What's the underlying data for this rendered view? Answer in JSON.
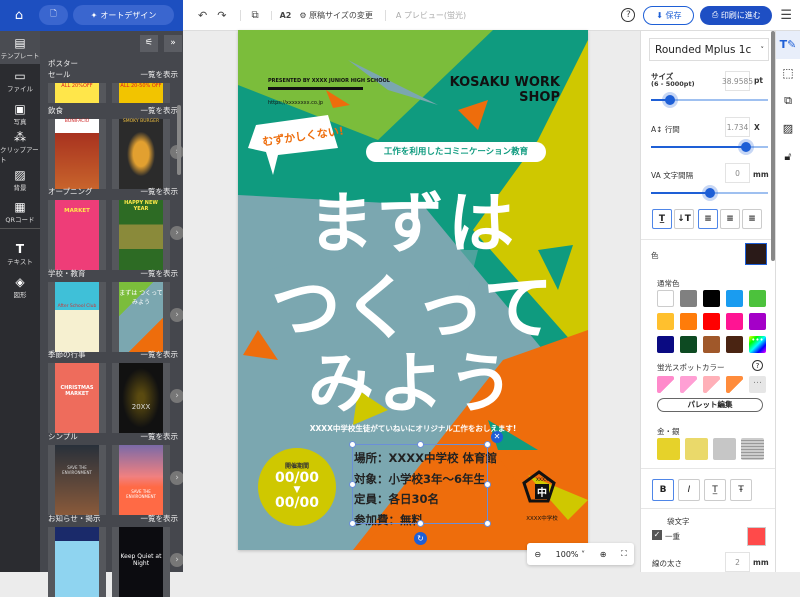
{
  "header": {
    "auto_design_label": "オートデザイン"
  },
  "rail": [
    {
      "label": "テンプレート",
      "icon": "template-icon"
    },
    {
      "label": "ファイル",
      "icon": "folder-icon"
    },
    {
      "label": "写真",
      "icon": "photo-icon"
    },
    {
      "label": "クリップアート",
      "icon": "clipart-icon"
    },
    {
      "label": "背景",
      "icon": "background-icon"
    },
    {
      "label": "QRコード",
      "icon": "qr-icon"
    },
    {
      "label": "テキスト",
      "icon": "text-icon"
    },
    {
      "label": "図形",
      "icon": "shape-icon"
    }
  ],
  "templates": {
    "show_all": "一覧を表示",
    "categories": [
      {
        "name": "ポスター\nセール",
        "thumbs": [
          "ALL 20%OFF",
          "ALL 20-50% OFF"
        ]
      },
      {
        "name": "飲食",
        "thumbs": [
          "BONIFACIO",
          "SMOKY BURGER"
        ]
      },
      {
        "name": "オープニング",
        "thumbs": [
          "MARKET",
          "HAPPY NEW YEAR"
        ]
      },
      {
        "name": "学校・教育",
        "thumbs": [
          "After School Club",
          "まずは つくって みよう"
        ]
      },
      {
        "name": "季節の行事",
        "thumbs": [
          "CHRISTMAS MARKET",
          "20XX"
        ]
      },
      {
        "name": "シンプル",
        "thumbs": [
          "SAVE THE ENVIRONMENT",
          "SAVE THE ENVIRONMENT"
        ]
      },
      {
        "name": "お知らせ・掲示",
        "thumbs": [
          "",
          "Keep Quiet at Night"
        ]
      }
    ]
  },
  "toolbar": {
    "paper_size": "A2",
    "change_size": "原稿サイズの変更",
    "preview": "プレビュー(蛍光)",
    "save": "保存",
    "print": "印刷に進む"
  },
  "poster": {
    "presented_by": "PRESENTED BY XXXX JUNIOR HIGH SCHOOL",
    "url": "https://xxxxxxxx.co.jp",
    "title1": "KOSAKU WORK",
    "title2": "SHOP",
    "bubble": "むずかしくない!",
    "pill": "工作を利用したコミニケーション教育",
    "line1": "まずは",
    "line2": "つくって",
    "line3": "みよう",
    "subtitle": "XXXX中学校生徒がていねいにオリジナル工作をおしえます!",
    "period_label": "開催期間",
    "date_from": "00/00",
    "date_to": "00/00",
    "details": [
      "場所：XXXX中学校 体育館",
      "対象：小学校3年〜6年生",
      "定員：各日30名",
      "参加費：無料"
    ],
    "badge_top": "XXXX",
    "badge_char": "中",
    "badge_name": "XXXX中学校"
  },
  "zoom": {
    "level": "100%"
  },
  "props": {
    "font": "Rounded Mplus 1c",
    "size_label": "サイズ",
    "size_range": "(6 - 5000pt)",
    "size_value": "38.9585",
    "size_unit": "pt",
    "size_slider": 0.16,
    "line_label": "行間",
    "line_value": "1.734",
    "line_unit": "X",
    "line_slider": 0.81,
    "spacing_label": "文字間隔",
    "spacing_value": "0",
    "spacing_unit": "mm",
    "spacing_slider": 0.5,
    "color_label": "色",
    "current_color": "#2a1a18",
    "normal_colors_label": "通常色",
    "normal_colors": [
      "#ffffff",
      "#808080",
      "#000000",
      "#1a9cf0",
      "#4cc23c",
      "#ffc02e",
      "#ff7c0a",
      "#ff0000",
      "#ff1493",
      "#a400c8",
      "#0a0a82",
      "#0d4a22",
      "#a0582a",
      "#4a2412"
    ],
    "fluor_label": "蛍光スポットカラー",
    "fluor_colors": [
      "#ff8acb",
      "#ff9fd4",
      "#ffb0b8",
      "#ff8c3c"
    ],
    "palette_edit": "パレット編集",
    "metal_label": "金・銀",
    "outline_label": "袋文字",
    "single_label": "一重",
    "outline_color": "#ff4a4a",
    "width_label": "線の太さ",
    "width_value": "2",
    "width_unit": "mm"
  }
}
